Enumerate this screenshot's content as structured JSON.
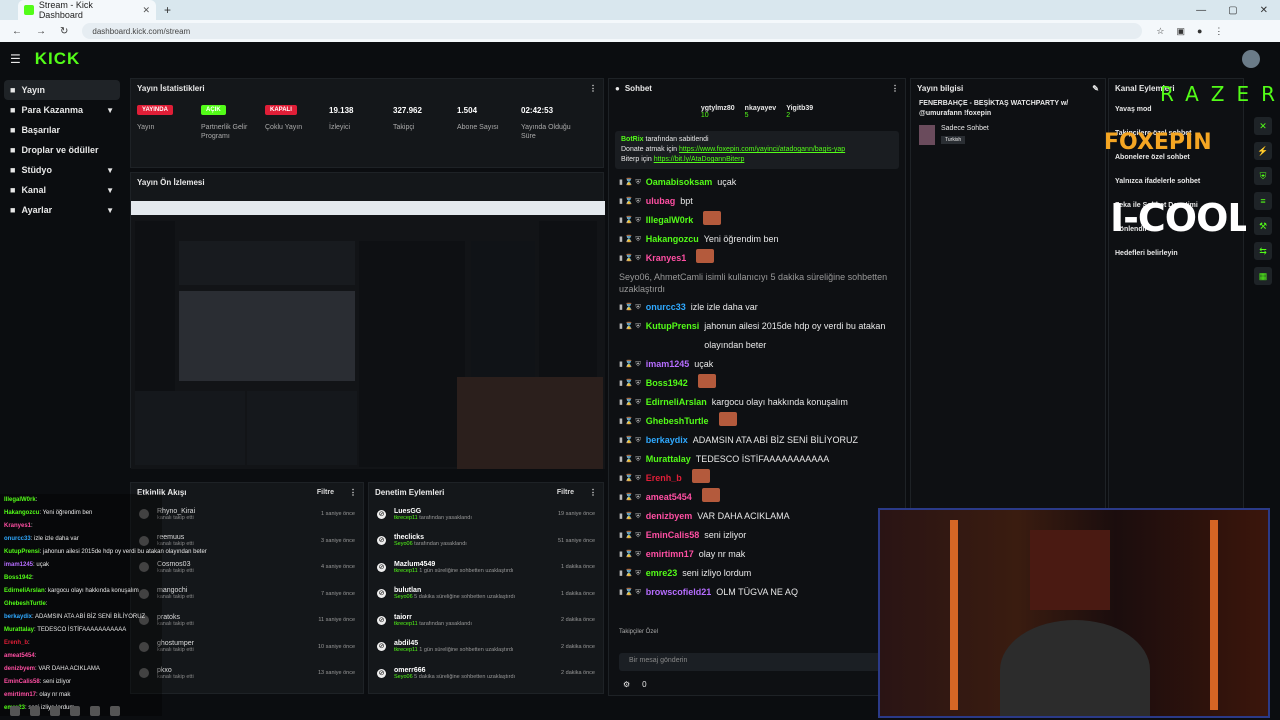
{
  "browser": {
    "tab_title": "Stream - Kick Dashboard",
    "url": "dashboard.kick.com/stream"
  },
  "app": {
    "logo": "KICK"
  },
  "sidebar": {
    "items": [
      {
        "label": "Yayın",
        "icon": "broadcast-icon",
        "active": true,
        "expand": false
      },
      {
        "label": "Para Kazanma",
        "icon": "money-icon",
        "expand": true
      },
      {
        "label": "Başarılar",
        "icon": "trophy-icon",
        "expand": false
      },
      {
        "label": "Droplar ve ödüller",
        "icon": "gift-icon",
        "expand": false
      },
      {
        "label": "Stüdyo",
        "icon": "studio-icon",
        "expand": true
      },
      {
        "label": "Kanal",
        "icon": "channel-icon",
        "expand": true
      },
      {
        "label": "Ayarlar",
        "icon": "settings-icon",
        "expand": true
      }
    ]
  },
  "stats": {
    "title": "Yayın İstatistikleri",
    "items": [
      {
        "value": "YAYINDA",
        "label": "Yayın",
        "badge": true,
        "color": "#e01e37"
      },
      {
        "value": "AÇIK",
        "label": "Partnerlik Gelir Programı",
        "badge": true,
        "color": "#53fc18"
      },
      {
        "value": "KAPALI",
        "label": "Çoklu Yayın",
        "badge": true,
        "color": "#e01e37"
      },
      {
        "value": "19.138",
        "label": "İzleyici"
      },
      {
        "value": "327.962",
        "label": "Takipçi"
      },
      {
        "value": "1.504",
        "label": "Abone Sayısı"
      },
      {
        "value": "02:42:53",
        "label": "Yayında Olduğu Süre"
      }
    ]
  },
  "preview": {
    "title": "Yayın Ön İzlemesi"
  },
  "activity": {
    "title": "Etkinlik Akışı",
    "filter": "Filtre",
    "rows": [
      {
        "name": "Rhyno_Kirai",
        "sub": "kanalı takip etti",
        "time": "1 saniye önce"
      },
      {
        "name": "reemuus",
        "sub": "kanalı takip etti",
        "time": "3 saniye önce"
      },
      {
        "name": "Cosmos03",
        "sub": "kanalı takip etti",
        "time": "4 saniye önce"
      },
      {
        "name": "mangochi",
        "sub": "kanalı takip etti",
        "time": "7 saniye önce"
      },
      {
        "name": "pratoks",
        "sub": "kanalı takip etti",
        "time": "11 saniye önce"
      },
      {
        "name": "ghostumper",
        "sub": "kanalı takip etti",
        "time": "10 saniye önce"
      },
      {
        "name": "pkxo",
        "sub": "kanalı takip etti",
        "time": "13 saniye önce"
      }
    ]
  },
  "moderation": {
    "title": "Denetim Eylemleri",
    "filter": "Filtre",
    "rows": [
      {
        "name": "LuesGG",
        "mod": "tkrecep11",
        "sub": " tarafından yasaklandı",
        "time": "19 saniye önce"
      },
      {
        "name": "theclicks",
        "mod": "Seyo06",
        "sub": " tarafından yasaklandı",
        "time": "51 saniye önce"
      },
      {
        "name": "Mazlum4549",
        "mod": "tkrecep11",
        "sub": " 1 gün süreliğine sohbetten uzaklaştırdı",
        "time": "1 dakika önce"
      },
      {
        "name": "bulutlan",
        "mod": "Seyo06",
        "sub": " 5 dakika süreliğine sohbetten uzaklaştırdı",
        "time": "1 dakika önce"
      },
      {
        "name": "taiorr",
        "mod": "tkrecep11",
        "sub": " tarafından yasaklandı",
        "time": "2 dakika önce"
      },
      {
        "name": "abdil45",
        "mod": "tkrecep11",
        "sub": " 1 gün süreliğine sohbetten uzaklaştırdı",
        "time": "2 dakika önce"
      },
      {
        "name": "omerr666",
        "mod": "Seyo06",
        "sub": " 5 dakika süreliğine sohbetten uzaklaştırdı",
        "time": "2 dakika önce"
      }
    ]
  },
  "chat": {
    "title": "Sohbet",
    "top_users": [
      {
        "name": "ygtylmz80",
        "count": "10"
      },
      {
        "name": "nkayayev",
        "count": "5"
      },
      {
        "name": "Yigitb39",
        "count": "2"
      }
    ],
    "pinned_by": "BotRix",
    "pinned_suffix": " tarafından sabitlendi",
    "pinned_line1_prefix": "Donate atmak için ",
    "pinned_link1": "https://www.foxepin.com/yayinci/atadogann/bagis-yap",
    "pinned_line2_prefix": "Biterp için ",
    "pinned_link2": "https://bit.ly/AtaDogannBiterp",
    "messages": [
      {
        "user": "Oamabisoksam",
        "color": "#53fc18",
        "text": "uçak"
      },
      {
        "user": "ulubag",
        "color": "#ff4fa3",
        "text": "bpt"
      },
      {
        "user": "IllegalW0rk",
        "color": "#53fc18",
        "text": "",
        "emote": true
      },
      {
        "user": "Hakangozcu",
        "color": "#53fc18",
        "text": "Yeni öğrendim ben"
      },
      {
        "user": "Kranyes1",
        "color": "#ff4fa3",
        "text": "",
        "emote": true
      },
      {
        "system": true,
        "text": "Seyo06, AhmetCamli isimli kullanıcıyı 5 dakika süreliğine sohbetten uzaklaştırdı"
      },
      {
        "user": "onurcc33",
        "color": "#2fa9ff",
        "text": "izle izle daha var"
      },
      {
        "user": "KutupPrensi",
        "color": "#53fc18",
        "text": "jahonun ailesi 2015de hdp oy verdi bu atakan olayından beter"
      },
      {
        "user": "imam1245",
        "color": "#b66dff",
        "text": "uçak"
      },
      {
        "user": "Boss1942",
        "color": "#53fc18",
        "text": "",
        "emote": true
      },
      {
        "user": "EdirneliArslan",
        "color": "#53fc18",
        "text": "kargocu olayı hakkında konuşalım"
      },
      {
        "user": "GhebeshTurtle",
        "color": "#53fc18",
        "text": "",
        "emote": true
      },
      {
        "user": "berkaydix",
        "color": "#2fa9ff",
        "text": "ADAMSIN ATA ABİ BİZ SENİ BİLİYORUZ"
      },
      {
        "user": "Murattalay",
        "color": "#53fc18",
        "text": "TEDESCO İSTİFAAAAAAAAAAA"
      },
      {
        "user": "Erenh_b",
        "color": "#e01e37",
        "text": "",
        "emote": true
      },
      {
        "user": "ameat5454",
        "color": "#ff4fa3",
        "text": "",
        "emote": true
      },
      {
        "user": "denizbyem",
        "color": "#ff4fa3",
        "text": "VAR DAHA ACIKLAMA"
      },
      {
        "user": "EminCalis58",
        "color": "#ff4fa3",
        "text": "seni izliyor"
      },
      {
        "user": "emirtimn17",
        "color": "#ff4fa3",
        "text": "olay nr mak"
      },
      {
        "user": "emre23",
        "color": "#53fc18",
        "text": "seni izliyo lordum"
      },
      {
        "user": "browscofield21",
        "color": "#b66dff",
        "text": "OLM TÜGVA NE AQ"
      }
    ],
    "follower_only": "Takipçiler Özel",
    "input_placeholder": "Bir mesaj gönderin",
    "bottom_count": "0"
  },
  "stream_info": {
    "title": "Yayın bilgisi",
    "stream_title": "FENERBAHÇE - BEŞİKTAŞ WATCHPARTY w/ @umurafann !foxepin",
    "category": "Sadece Sohbet",
    "tag": "Turkish"
  },
  "channel_actions": {
    "title": "Kanal Eylemleri",
    "items": [
      "Yavaş mod",
      "Takipçilere özel sohbet",
      "Abonelere özel sohbet",
      "Yalnızca ifadelerle sohbet",
      "Zeka ile Sohbet Denetimi",
      "Yönlendir",
      "Hedefleri belirleyin"
    ]
  },
  "overlay_brands": {
    "razer": "RAZER",
    "foxepin": "FOXEPIN",
    "cool": "I-COOL"
  },
  "left_chat": [
    {
      "user": "IllegalW0rk",
      "color": "#53fc18",
      "text": ""
    },
    {
      "user": "Hakangozcu",
      "color": "#53fc18",
      "text": "Yeni öğrendim ben"
    },
    {
      "user": "Kranyes1",
      "color": "#ff4fa3",
      "text": ""
    },
    {
      "user": "onurcc33",
      "color": "#2fa9ff",
      "text": "izle izle daha var"
    },
    {
      "user": "KutupPrensi",
      "color": "#53fc18",
      "text": "jahonun ailesi 2015de hdp oy verdi bu atakan olayından beter"
    },
    {
      "user": "imam1245",
      "color": "#b66dff",
      "text": "uçak"
    },
    {
      "user": "Boss1942",
      "color": "#53fc18",
      "text": ""
    },
    {
      "user": "EdirneliArslan",
      "color": "#53fc18",
      "text": "kargocu olayı hakkında konuşalım"
    },
    {
      "user": "GhebeshTurtle",
      "color": "#53fc18",
      "text": ""
    },
    {
      "user": "berkaydix",
      "color": "#2fa9ff",
      "text": "ADAMSIN ATA ABİ BİZ SENİ BİLİYORUZ"
    },
    {
      "user": "Murattalay",
      "color": "#53fc18",
      "text": "TEDESCO İSTİFAAAAAAAAAAA"
    },
    {
      "user": "Erenh_b",
      "color": "#e01e37",
      "text": ""
    },
    {
      "user": "ameat5454",
      "color": "#ff4fa3",
      "text": ""
    },
    {
      "user": "denizbyem",
      "color": "#ff4fa3",
      "text": "VAR DAHA ACIKLAMA"
    },
    {
      "user": "EminCalis58",
      "color": "#ff4fa3",
      "text": "seni izliyor"
    },
    {
      "user": "emirtimn17",
      "color": "#ff4fa3",
      "text": "olay nr mak"
    },
    {
      "user": "emre23",
      "color": "#53fc18",
      "text": "seni izliyo lordum"
    }
  ]
}
